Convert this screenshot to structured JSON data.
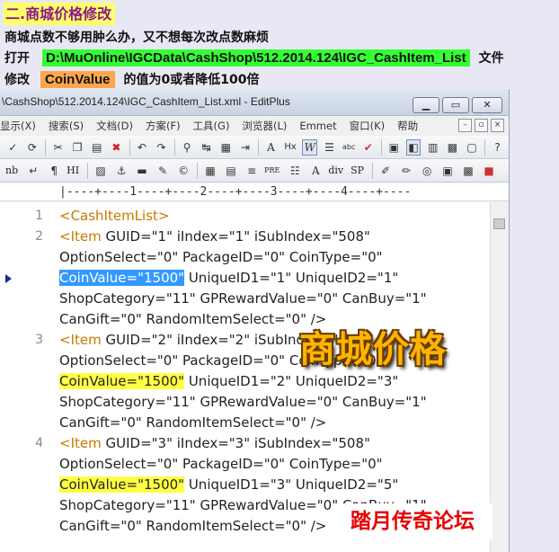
{
  "header": {
    "title": "二.商城价格修改",
    "line2": "商城点数不够用肿么办，又不想每次改点数麻烦",
    "line3_pre": "打开",
    "line3_path": "D:\\MuOnline\\IGCData\\CashShop\\512.2014.124\\IGC_CashItem_List",
    "line3_post": "文件",
    "line4_pre": "修改",
    "line4_key": "CoinValue",
    "line4_post": "的值为0或者降低100倍"
  },
  "window": {
    "title": "\\CashShop\\512.2014.124\\IGC_CashItem_List.xml - EditPlus",
    "min_label": "▁",
    "max_label": "▭",
    "close_label": "✕"
  },
  "menu": [
    "显示(X)",
    "搜索(S)",
    "文档(D)",
    "方案(F)",
    "工具(G)",
    "浏览器(L)",
    "Emmet",
    "窗口(K)",
    "帮助"
  ],
  "mdi": [
    "–",
    "▫",
    "×"
  ],
  "toolbar2_text": {
    "nb": "nb",
    "hi": "HI",
    "ahx": "Hx",
    "pre": "PRE",
    "div": "div",
    "sp": "SP"
  },
  "ruler": "|----+----1----+----2----+----3----+----4----+----",
  "lines": [
    {
      "num": "1",
      "parts": [
        {
          "t": "<CashItemList>",
          "c": "tag"
        }
      ]
    },
    {
      "num": "2",
      "parts": [
        {
          "t": "<Item",
          "c": "tag"
        },
        {
          "t": " GUID=\"1\" iIndex=\"1\" iSubIndex=\"508\"",
          "c": ""
        }
      ]
    },
    {
      "num": "",
      "parts": [
        {
          "t": "OptionSelect=\"0\" PackageID=\"0\" CoinType=\"0\"",
          "c": ""
        }
      ]
    },
    {
      "num": "",
      "parts": [
        {
          "t": "CoinValue=\"1500\"",
          "c": "sel"
        },
        {
          "t": " UniqueID1=\"1\" UniqueID2=\"1\"",
          "c": ""
        }
      ]
    },
    {
      "num": "",
      "parts": [
        {
          "t": "ShopCategory=\"11\" GPRewardValue=\"0\" CanBuy=\"1\"",
          "c": ""
        }
      ]
    },
    {
      "num": "",
      "parts": [
        {
          "t": "CanGift=\"0\" RandomItemSelect=\"0\" />",
          "c": ""
        }
      ]
    },
    {
      "num": "3",
      "parts": [
        {
          "t": "<Item",
          "c": "tag"
        },
        {
          "t": " GUID=\"2\" iIndex=\"2\" iSubIndex=\"508\"",
          "c": ""
        }
      ]
    },
    {
      "num": "",
      "parts": [
        {
          "t": "OptionSelect=\"0\" PackageID=\"0\" CoinType=\"0\"",
          "c": ""
        }
      ]
    },
    {
      "num": "",
      "parts": [
        {
          "t": "CoinValue=\"1500\"",
          "c": "yhl"
        },
        {
          "t": " UniqueID1=\"2\" UniqueID2=\"3\"",
          "c": ""
        }
      ]
    },
    {
      "num": "",
      "parts": [
        {
          "t": "ShopCategory=\"11\" GPRewardValue=\"0\" CanBuy=\"1\"",
          "c": ""
        }
      ]
    },
    {
      "num": "",
      "parts": [
        {
          "t": "CanGift=\"0\" RandomItemSelect=\"0\" />",
          "c": ""
        }
      ]
    },
    {
      "num": "4",
      "parts": [
        {
          "t": "<Item",
          "c": "tag"
        },
        {
          "t": " GUID=\"3\" iIndex=\"3\" iSubIndex=\"508\"",
          "c": ""
        }
      ]
    },
    {
      "num": "",
      "parts": [
        {
          "t": "OptionSelect=\"0\" PackageID=\"0\" CoinType=\"0\"",
          "c": ""
        }
      ]
    },
    {
      "num": "",
      "parts": [
        {
          "t": "CoinValue=\"1500\"",
          "c": "yhl"
        },
        {
          "t": " UniqueID1=\"3\" UniqueID2=\"5\"",
          "c": ""
        }
      ]
    },
    {
      "num": "",
      "parts": [
        {
          "t": "ShopCategory=\"11\" GPRewardValue=\"0\" CanBuy=\"1\"",
          "c": ""
        }
      ]
    },
    {
      "num": "",
      "parts": [
        {
          "t": "CanGift=\"0\" RandomItemSelect=\"0\" />",
          "c": ""
        }
      ]
    }
  ],
  "overlay": {
    "big": "商城价格",
    "watermark": "踏月传奇论坛"
  }
}
